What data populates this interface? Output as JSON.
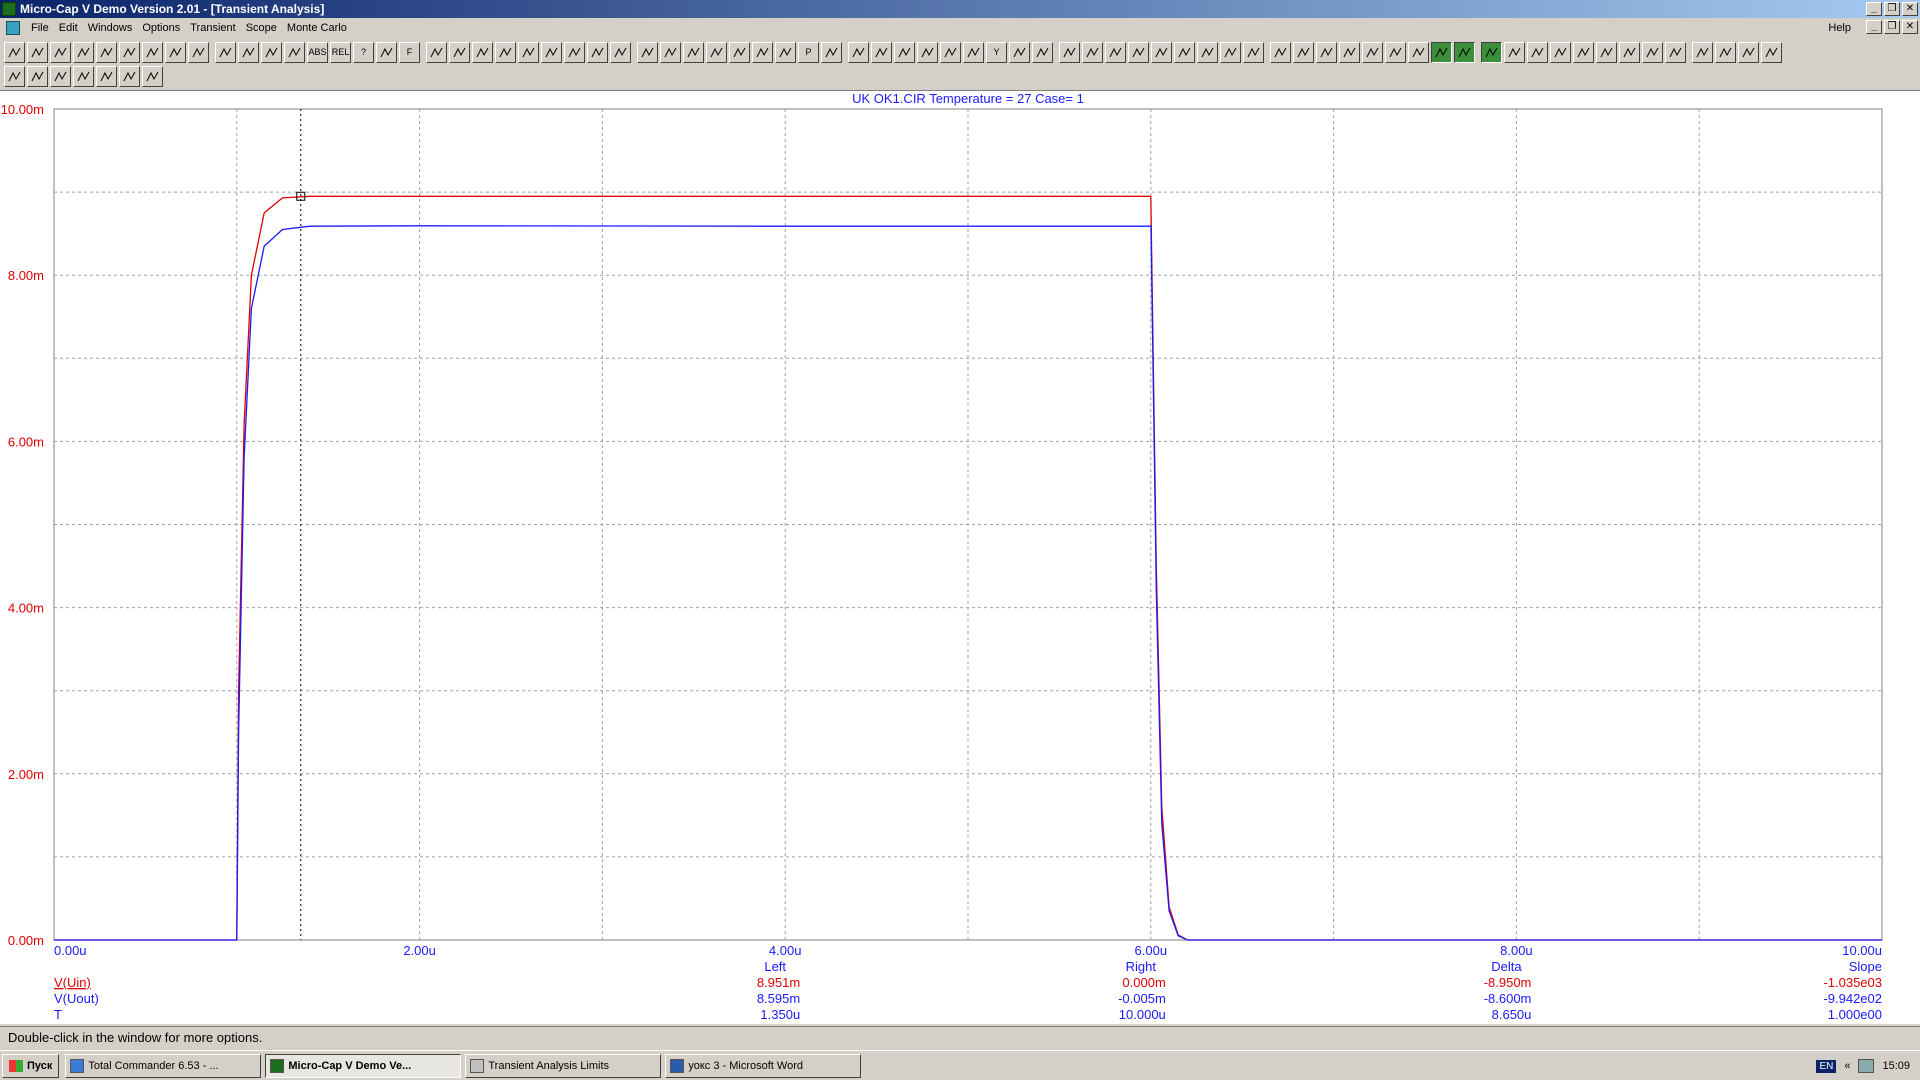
{
  "window": {
    "title": "Micro-Cap V Demo Version 2.01 - [Transient Analysis]",
    "controls": [
      "_",
      "❐",
      "✕"
    ]
  },
  "menu": {
    "items": [
      "File",
      "Edit",
      "Windows",
      "Options",
      "Transient",
      "Scope",
      "Monte Carlo"
    ],
    "help": "Help"
  },
  "toolbar1": {
    "buttons": [
      "arrow-icon",
      "component-icon",
      "line-icon",
      "ellipse-icon",
      "rect-icon",
      "diamond-icon",
      "arc-icon",
      "pie-icon",
      "curve-icon",
      "bar-icon",
      "capacitor-icon",
      "wire-icon",
      "text-icon",
      "ABS",
      "REL",
      "?",
      "slash-icon",
      "F",
      "move-icon",
      "cross-icon",
      "fill-icon",
      "pattern-icon",
      "dots-icon",
      "table-icon",
      "window-icon",
      "split-icon",
      "tile-icon",
      "window2-icon",
      "grid-icon",
      "x-icon",
      "page-icon",
      "print-icon",
      "preview-icon",
      "fit-icon",
      "P",
      "zoom-in-icon",
      "zoom-out-icon",
      "wave-icon",
      "wave2-icon",
      "graph-icon",
      "graph2-icon",
      "table2-icon",
      "Y",
      "hist-icon",
      "hist2-icon",
      "hist3-icon",
      "hist4-icon",
      "box-icon",
      "box2-icon",
      "box3-icon",
      "box4-icon",
      "line2-icon",
      "line3-icon",
      "line4-icon",
      "cross2-icon",
      "dotbox-icon",
      "box5-icon",
      "box6-icon",
      "slope-icon",
      "frame-icon",
      "diag-icon",
      "green1",
      "green2",
      "green3",
      "rect2-icon",
      "peak-icon",
      "peak2-icon",
      "peak3-icon",
      "peak4-icon",
      "peak5-icon",
      "peak6-icon",
      "peak7-icon",
      "peak8-icon",
      "peak9-icon",
      "slope2-icon",
      "slope3-icon",
      "slope4-icon",
      "run-icon",
      "stop-icon",
      "pause-icon"
    ]
  },
  "toolbar2": {
    "buttons": [
      "tb2-1",
      "tb2-2",
      "tb2-3",
      "tb2-4",
      "tb2-5",
      "tb2-6",
      "tb2-7"
    ]
  },
  "chart_data": {
    "type": "line",
    "title": "UK  OK1.CIR Temperature = 27 Case= 1",
    "xlim": [
      0,
      10
    ],
    "ylim": [
      0,
      10
    ],
    "x_ticks": [
      "0.00u",
      "2.00u",
      "4.00u",
      "6.00u",
      "8.00u",
      "10.00u"
    ],
    "y_ticks": [
      "0.00m",
      "2.00m",
      "4.00m",
      "6.00m",
      "8.00m",
      "10.00m"
    ],
    "grid": true,
    "cursor_x": 1.35,
    "series": [
      {
        "name": "V(Uin)",
        "color": "#e00000",
        "x": [
          0,
          1.0,
          1.01,
          1.04,
          1.08,
          1.15,
          1.25,
          1.4,
          2.0,
          4.0,
          6.0,
          6.0001,
          6.03,
          6.06,
          6.1,
          6.15,
          6.2,
          10.0
        ],
        "y": [
          0,
          0,
          3.0,
          6.2,
          8.0,
          8.75,
          8.93,
          8.95,
          8.95,
          8.95,
          8.95,
          8.95,
          4.5,
          1.6,
          0.4,
          0.06,
          0,
          0
        ]
      },
      {
        "name": "V(Uout)",
        "color": "#1a1aff",
        "x": [
          0,
          1.0,
          1.01,
          1.04,
          1.08,
          1.15,
          1.25,
          1.4,
          2.0,
          4.0,
          6.0,
          6.001,
          6.03,
          6.06,
          6.1,
          6.15,
          6.2,
          10.0
        ],
        "y": [
          0,
          0,
          2.5,
          5.8,
          7.6,
          8.35,
          8.55,
          8.59,
          8.595,
          8.59,
          8.59,
          8.59,
          4.2,
          1.4,
          0.35,
          0.05,
          0,
          0
        ]
      }
    ],
    "readout": {
      "headers": [
        "Left",
        "Right",
        "Delta",
        "Slope"
      ],
      "rows": [
        {
          "label": "V(Uin)",
          "color": "#e00000",
          "values": [
            "8.951m",
            "0.000m",
            "-8.950m",
            "-1.035e03"
          ]
        },
        {
          "label": "V(Uout)",
          "color": "#1a1aff",
          "values": [
            "8.595m",
            "-0.005m",
            "-8.600m",
            "-9.942e02"
          ]
        },
        {
          "label": "T",
          "color": "#1a1aff",
          "values": [
            "1.350u",
            "10.000u",
            "8.650u",
            "1.000e00"
          ]
        }
      ]
    }
  },
  "status": {
    "text": "Double-click in the window for more options."
  },
  "taskbar": {
    "start": "Пуск",
    "tasks": [
      {
        "label": "Total Commander 6.53 - ...",
        "active": false
      },
      {
        "label": "Micro-Cap V Demo Ve...",
        "active": true
      },
      {
        "label": "Transient Analysis Limits",
        "active": false
      },
      {
        "label": "уокс 3 - Microsoft Word",
        "active": false
      }
    ],
    "lang": "EN",
    "chevron": "«",
    "time": "15:09"
  }
}
